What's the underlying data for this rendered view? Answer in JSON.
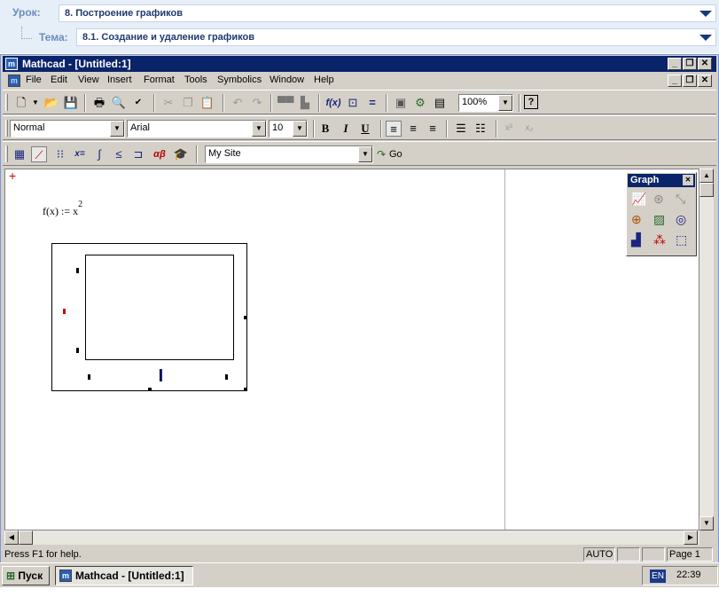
{
  "lesson": {
    "urok_label": "Урок:",
    "urok_value": "8. Построение графиков",
    "tema_label": "Тема:",
    "tema_value": "8.1. Создание и удаление графиков"
  },
  "window": {
    "title": "Mathcad - [Untitled:1]",
    "controls": [
      "_",
      "❐",
      "✕"
    ]
  },
  "menu": [
    "File",
    "Edit",
    "View",
    "Insert",
    "Format",
    "Tools",
    "Symbolics",
    "Window",
    "Help"
  ],
  "toolbar_standard": {
    "zoom": "100%",
    "icons": [
      "new-document-icon",
      "open-icon",
      "save-icon",
      "print-icon",
      "print-preview-icon",
      "spell-check-icon",
      "cut-icon",
      "copy-icon",
      "paste-icon",
      "undo-icon",
      "redo-icon",
      "align-across-icon",
      "align-down-icon",
      "insert-function-icon",
      "insert-unit-icon",
      "calculate-icon",
      "insert-picture-icon",
      "component-wizard-icon",
      "insert-table-icon",
      "help-icon"
    ]
  },
  "toolbar_formatting": {
    "style": "Normal",
    "font": "Arial",
    "size": "10",
    "bold": "B",
    "italic": "I",
    "underline": "U",
    "superscript": "x²",
    "subscript": "x₂"
  },
  "toolbar_math": {
    "site": "My Site",
    "go": "Go",
    "eval_label": "x=",
    "greek_label": "αβ"
  },
  "document": {
    "formula_lhs": "f(x) := x",
    "formula_exp": "2"
  },
  "graph_palette": {
    "title": "Graph",
    "close": "✕",
    "icons": [
      "xy-plot-icon",
      "polar-plot-icon",
      "zoom-icon",
      "surface-plot-icon",
      "contour-plot-icon",
      "trace-icon",
      "bar-3d-plot-icon",
      "scatter-3d-plot-icon",
      "vector-field-plot-icon"
    ]
  },
  "status": {
    "help": "Press F1 for help.",
    "mode": "AUTO",
    "page": "Page 1"
  },
  "taskbar": {
    "start": "Пуск",
    "task": "Mathcad - [Untitled:1]",
    "lang": "EN",
    "time": "22:39"
  },
  "colors": {
    "titlebar": "#0a246a",
    "lesson_bg": "#e6eef8",
    "label": "#6b8cbf",
    "marker": "#cc0000"
  }
}
